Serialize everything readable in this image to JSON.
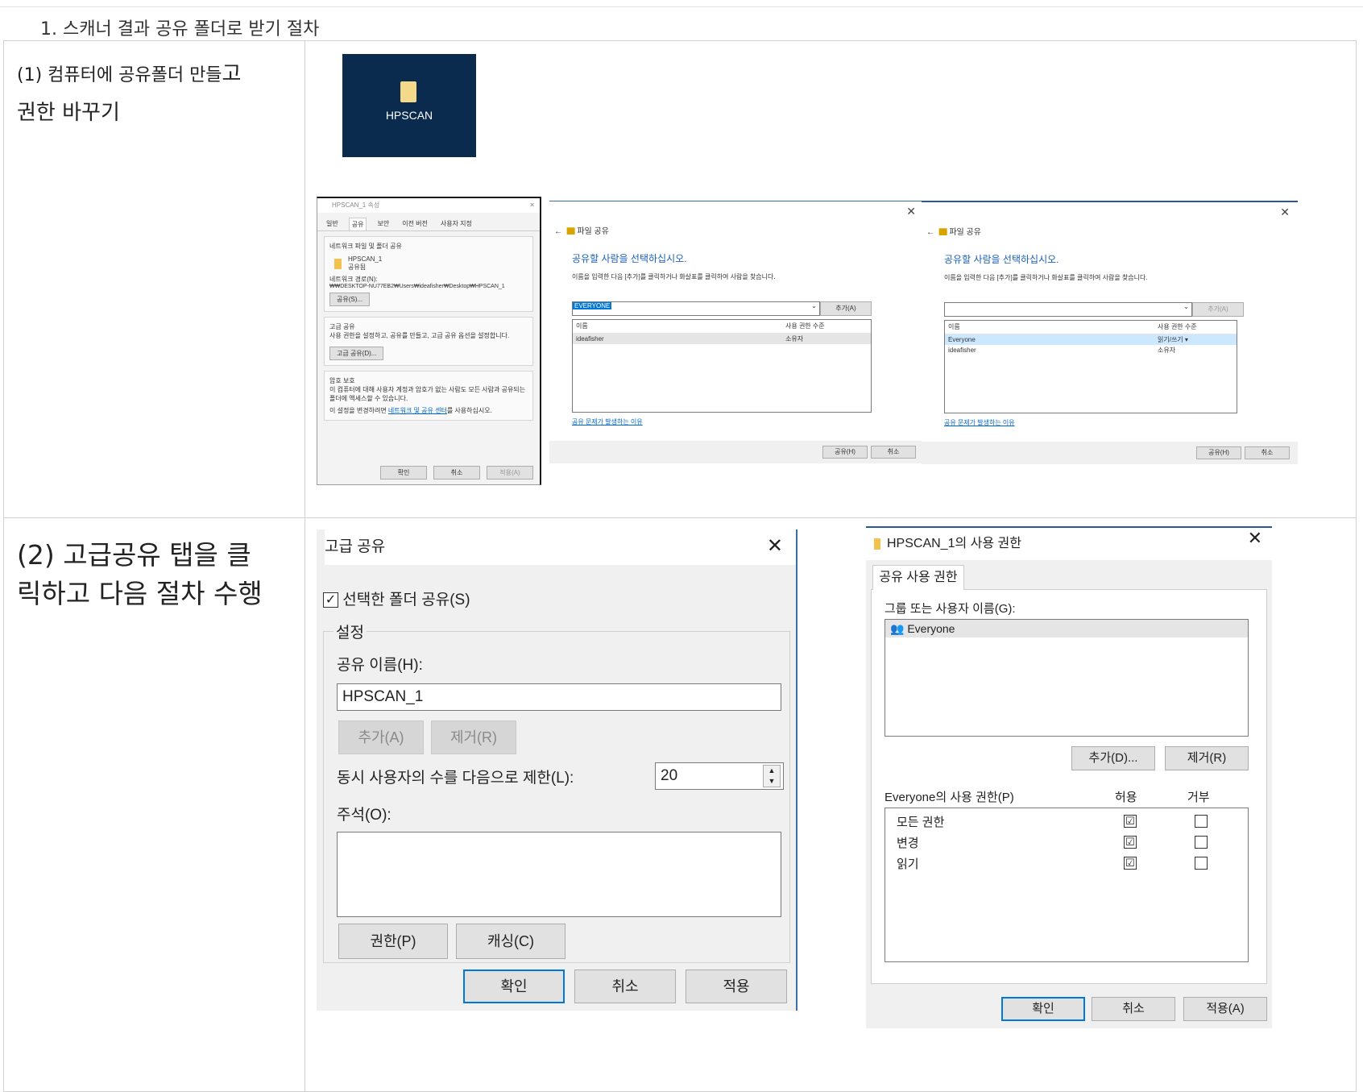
{
  "heading": "1. 스캐너 결과 공유 폴더로 받기 절차",
  "step1": {
    "label_a": "(1) 컴퓨터에 공유폴더 만들",
    "label_b": "고",
    "label_c": "권한 바꾸기",
    "desktop_icon_label": "HPSCAN",
    "properties": {
      "title": "HPSCAN_1 속성",
      "tabs": [
        "일반",
        "공유",
        "보안",
        "이전 버전",
        "사용자 지정"
      ],
      "group1_title": "네트워크 파일 및 폴더 공유",
      "folder_name": "HPSCAN_1",
      "folder_state": "공유됨",
      "path_label": "네트워크 경로(N):",
      "path": "₩₩DESKTOP-NU77EB2₩Users₩ideafisher₩Desktop₩HPSCAN_1",
      "share_button": "공유(S)...",
      "group2_title": "고급 공유",
      "group2_text": "사용 권한을 설정하고, 공유를 만들고, 고급 공유 옵션을 설정합니다.",
      "advanced_button": "고급 공유(D)...",
      "group3_title": "암호 보호",
      "group3_text": "이 컴퓨터에 대해 사용자 계정과 암호가 없는 사람도 모든 사람과 공유되는 폴더에 액세스할 수 있습니다.",
      "group3_text2": "이 설정을 변경하려면",
      "group3_link": "네트워크 및 공유 센터",
      "group3_text3": "를 사용하십시오.",
      "ok": "확인",
      "cancel": "취소",
      "apply": "적용(A)"
    },
    "share_dialog1": {
      "nav": "파일 공유",
      "title": "공유할 사람을 선택하십시오.",
      "subtitle": "이름을 입력한 다음 [추가]를 클릭하거나 화살표를 클릭하여 사람을 찾습니다.",
      "combo_value": "EVERYONE",
      "add": "추가(A)",
      "col_name": "이름",
      "col_level": "사용 권한 수준",
      "rows": [
        {
          "name": "ideafisher",
          "level": "소유자"
        }
      ],
      "link": "공유 문제가 발생하는 이유",
      "share_button": "공유(H)",
      "cancel": "취소"
    },
    "share_dialog2": {
      "nav": "파일 공유",
      "title": "공유할 사람을 선택하십시오.",
      "subtitle": "이름을 입력한 다음 [추가]를 클릭하거나 화살표를 클릭하여 사람을 찾습니다.",
      "add": "추가(A)",
      "col_name": "이름",
      "col_level": "사용 권한 수준",
      "rows": [
        {
          "name": "Everyone",
          "level": "읽기/쓰기 ▾"
        },
        {
          "name": "ideafisher",
          "level": "소유자"
        }
      ],
      "link": "공유 문제가 발생하는 이유",
      "share_button": "공유(H)",
      "cancel": "취소"
    }
  },
  "step2": {
    "label_line1": "(2) 고급공유 탭을 클",
    "label_line2": "릭하고 다음 절차 수행",
    "advanced": {
      "title": "고급 공유",
      "share_checkbox": "선택한 폴더 공유(S)",
      "group": "설정",
      "share_name_label": "공유 이름(H):",
      "share_name": "HPSCAN_1",
      "add": "추가(A)",
      "remove": "제거(R)",
      "limit_label": "동시 사용자의 수를 다음으로 제한(L):",
      "limit_value": "20",
      "comment_label": "주석(O):",
      "permissions": "권한(P)",
      "caching": "캐싱(C)",
      "ok": "확인",
      "cancel": "취소",
      "apply": "적용"
    },
    "permissions": {
      "title": "HPSCAN_1의 사용 권한",
      "tab": "공유 사용 권한",
      "group_label": "그룹 또는 사용자 이름(G):",
      "user": "Everyone",
      "add": "추가(D)...",
      "remove": "제거(R)",
      "perm_label": "Everyone의 사용 권한(P)",
      "allow": "허용",
      "deny": "거부",
      "rows": [
        {
          "name": "모든 권한",
          "allow": "☑",
          "deny": ""
        },
        {
          "name": "변경",
          "allow": "☑",
          "deny": ""
        },
        {
          "name": "읽기",
          "allow": "☑",
          "deny": ""
        }
      ],
      "ok": "확인",
      "cancel": "취소",
      "apply": "적용(A)"
    }
  }
}
